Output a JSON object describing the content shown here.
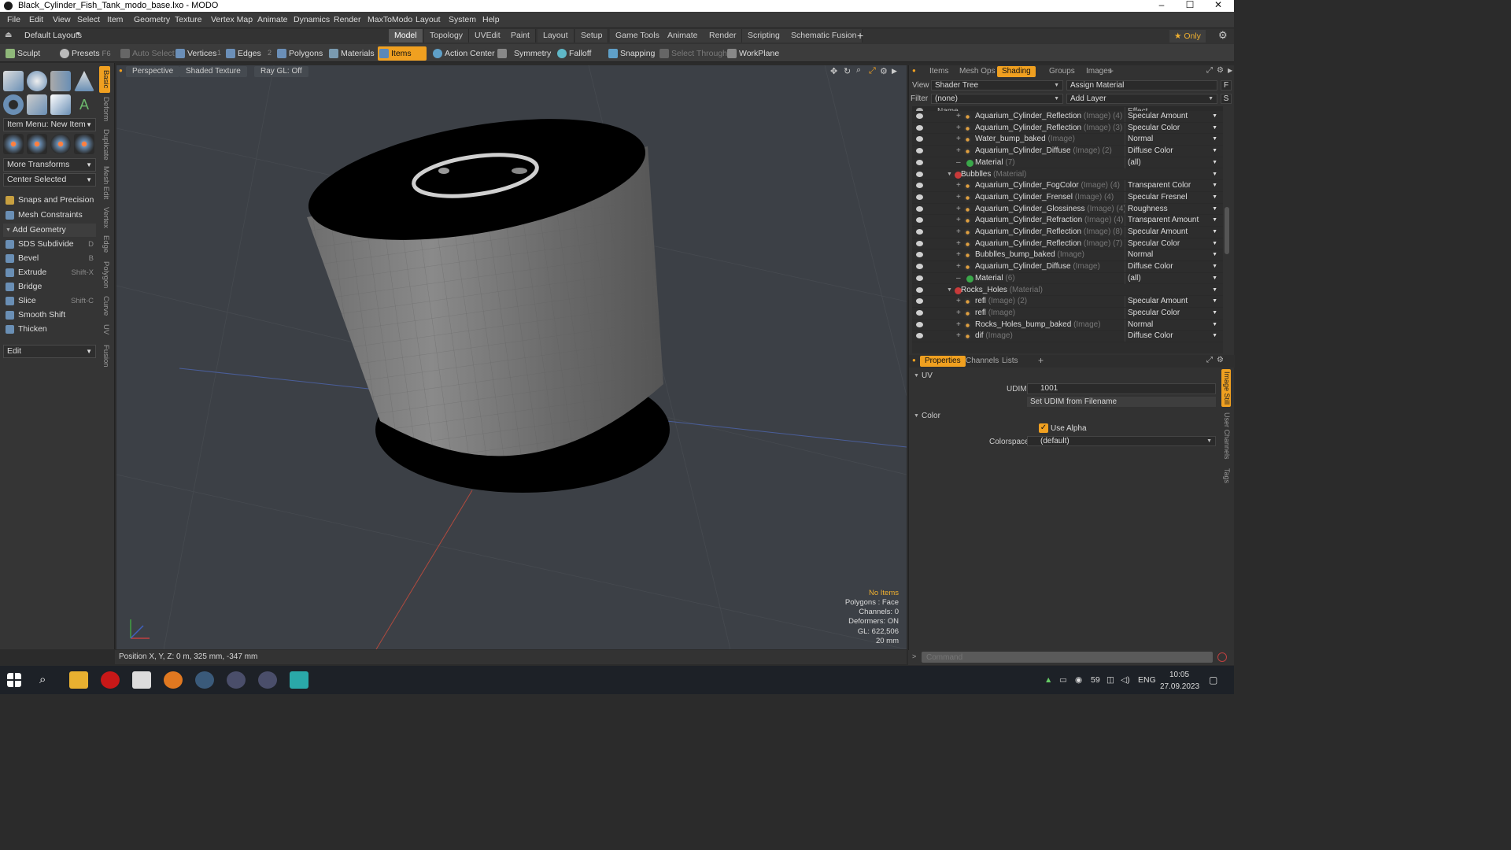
{
  "window": {
    "title": "Black_Cylinder_Fish_Tank_modo_base.lxo - MODO",
    "min": "–",
    "max": "☐",
    "close": "✕"
  },
  "menu": [
    "File",
    "Edit",
    "View",
    "Select",
    "Item",
    "Geometry",
    "Texture",
    "Vertex Map",
    "Animate",
    "Dynamics",
    "Render",
    "MaxToModo",
    "Layout",
    "System",
    "Help"
  ],
  "layout_bar": {
    "layout_name": "Default Layouts",
    "tabs": [
      "Model",
      "Topology",
      "UVEdit",
      "Paint",
      "Layout",
      "Setup",
      "Game Tools",
      "Animate",
      "Render",
      "Scripting",
      "Schematic Fusion"
    ],
    "active_tab": "Model",
    "add": "+",
    "only": "★  Only",
    "gear": "⚙"
  },
  "toolbar": {
    "sculpt": "Sculpt",
    "presets": "Presets",
    "presets_key": "F6",
    "auto_select": "Auto Select",
    "vertices": "Vertices",
    "vertices_count": "1",
    "edges": "Edges",
    "edges_count": "2",
    "polygons": "Polygons",
    "materials": "Materials",
    "items": "Items",
    "action_center": "Action Center",
    "symmetry": "Symmetry",
    "falloff": "Falloff",
    "snapping": "Snapping",
    "select_through": "Select Through",
    "workplane": "WorkPlane"
  },
  "left_panel": {
    "item_menu": "Item Menu: New Item",
    "more_transforms": "More Transforms",
    "center_selected": "Center Selected",
    "snaps": "Snaps and Precision",
    "mesh_constraints": "Mesh Constraints",
    "add_geometry": "Add Geometry",
    "tools": [
      {
        "label": "SDS Subdivide",
        "key": "D"
      },
      {
        "label": "Bevel",
        "key": "B"
      },
      {
        "label": "Extrude",
        "key": "Shift-X"
      },
      {
        "label": "Bridge",
        "key": ""
      },
      {
        "label": "Slice",
        "key": "Shift-C"
      },
      {
        "label": "Smooth Shift",
        "key": ""
      },
      {
        "label": "Thicken",
        "key": ""
      }
    ],
    "edit": "Edit",
    "vtabs": [
      "Basic",
      "Deform",
      "Duplicate",
      "Mesh Edit",
      "Vertex",
      "Edge",
      "Polygon",
      "Curve",
      "UV",
      "Fusion"
    ]
  },
  "viewport": {
    "perspective": "Perspective",
    "shading": "Shaded Texture",
    "raygl": "Ray GL: Off",
    "stats": {
      "no_items": "No Items",
      "polygons": "Polygons : Face",
      "channels": "Channels: 0",
      "deformers": "Deformers: ON",
      "gl": "GL: 622,506",
      "scale": "20 mm"
    }
  },
  "status": {
    "position": "Position X, Y, Z:  0 m, 325 mm, -347 mm"
  },
  "right_panel": {
    "tabs": [
      "Items",
      "Mesh Ops",
      "Shading",
      "Groups",
      "Images"
    ],
    "active_tab": "Shading",
    "view_label": "View",
    "view_value": "Shader Tree",
    "assign_material": "Assign Material",
    "f_btn": "F",
    "filter_label": "Filter",
    "filter_value": "(none)",
    "add_layer": "Add Layer",
    "s_btn": "S",
    "col_name": "Name",
    "col_effect": "Effect",
    "rows": [
      {
        "indent": 2,
        "name": "Aquarium_Cylinder_Reflection",
        "type": "(Image) (4)",
        "effect": "Specular Amount",
        "kind": "img"
      },
      {
        "indent": 2,
        "name": "Aquarium_Cylinder_Reflection",
        "type": "(Image) (3)",
        "effect": "Specular Color",
        "kind": "img"
      },
      {
        "indent": 2,
        "name": "Water_bump_baked",
        "type": "(Image)",
        "effect": "Normal",
        "kind": "img"
      },
      {
        "indent": 2,
        "name": "Aquarium_Cylinder_Diffuse",
        "type": "(Image) (2)",
        "effect": "Diffuse Color",
        "kind": "img"
      },
      {
        "indent": 2,
        "name": "Material",
        "type": "(7)",
        "effect": "(all)",
        "kind": "mat"
      },
      {
        "indent": 1,
        "name": "Bubblles",
        "type": "(Material)",
        "effect": "",
        "kind": "grp"
      },
      {
        "indent": 2,
        "name": "Aquarium_Cylinder_FogColor",
        "type": "(Image) (4)",
        "effect": "Transparent Color",
        "kind": "img"
      },
      {
        "indent": 2,
        "name": "Aquarium_Cylinder_Frensel",
        "type": "(Image) (4)",
        "effect": "Specular Fresnel",
        "kind": "img"
      },
      {
        "indent": 2,
        "name": "Aquarium_Cylinder_Glossiness",
        "type": "(Image) (4)",
        "effect": "Roughness",
        "kind": "img"
      },
      {
        "indent": 2,
        "name": "Aquarium_Cylinder_Refraction",
        "type": "(Image) (4)",
        "effect": "Transparent Amount",
        "kind": "img"
      },
      {
        "indent": 2,
        "name": "Aquarium_Cylinder_Reflection",
        "type": "(Image) (8)",
        "effect": "Specular Amount",
        "kind": "img"
      },
      {
        "indent": 2,
        "name": "Aquarium_Cylinder_Reflection",
        "type": "(Image) (7)",
        "effect": "Specular Color",
        "kind": "img"
      },
      {
        "indent": 2,
        "name": "Bubblles_bump_baked",
        "type": "(Image)",
        "effect": "Normal",
        "kind": "img"
      },
      {
        "indent": 2,
        "name": "Aquarium_Cylinder_Diffuse",
        "type": "(Image)",
        "effect": "Diffuse Color",
        "kind": "img"
      },
      {
        "indent": 2,
        "name": "Material",
        "type": "(6)",
        "effect": "(all)",
        "kind": "mat"
      },
      {
        "indent": 1,
        "name": "Rocks_Holes",
        "type": "(Material)",
        "effect": "",
        "kind": "grp"
      },
      {
        "indent": 2,
        "name": "refl",
        "type": "(Image) (2)",
        "effect": "Specular Amount",
        "kind": "img"
      },
      {
        "indent": 2,
        "name": "refl",
        "type": "(Image)",
        "effect": "Specular Color",
        "kind": "img"
      },
      {
        "indent": 2,
        "name": "Rocks_Holes_bump_baked",
        "type": "(Image)",
        "effect": "Normal",
        "kind": "img"
      },
      {
        "indent": 2,
        "name": "dif",
        "type": "(Image)",
        "effect": "Diffuse Color",
        "kind": "img"
      }
    ],
    "prop_tabs": [
      "Properties",
      "Channels",
      "Lists"
    ],
    "prop_add": "+",
    "uv_section": "UV",
    "udim_label": "UDIM",
    "udim_value": "1001",
    "set_udim": "Set UDIM from Filename",
    "color_section": "Color",
    "use_alpha": "Use Alpha",
    "colorspace_label": "Colorspace",
    "colorspace_value": "(default)",
    "side_tabs": [
      "Image Still",
      "User Channels",
      "Tags"
    ],
    "command_placeholder": "Command"
  },
  "taskbar": {
    "lang": "ENG",
    "time": "10:05",
    "date": "27.09.2023",
    "temp": "59"
  },
  "colors": {
    "accent": "#f0a020",
    "viewport_bg": "#3c4046",
    "panel_bg": "#353535"
  }
}
